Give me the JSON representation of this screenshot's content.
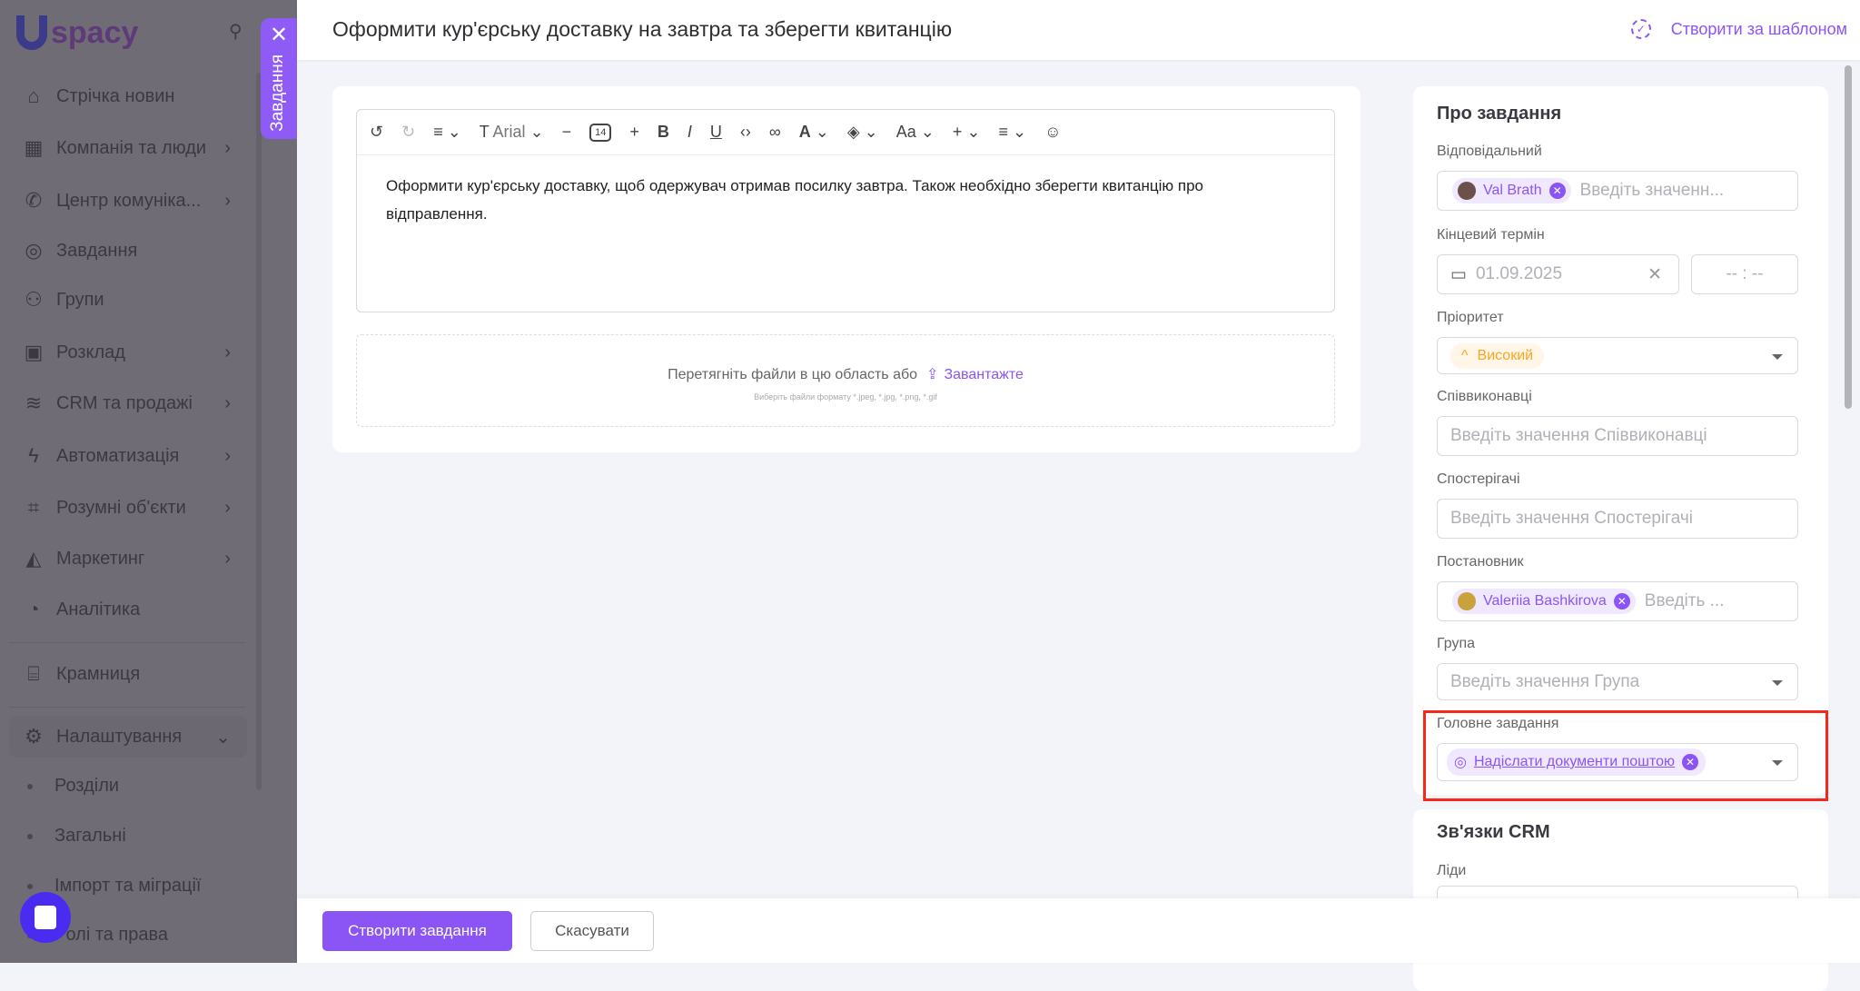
{
  "sidebar": {
    "logo": "spacy",
    "items": [
      {
        "label": "Стрічка новин",
        "icon": "home-icon",
        "chevron": false
      },
      {
        "label": "Компанія та люди",
        "icon": "building-icon",
        "chevron": true
      },
      {
        "label": "Центр комуніка...",
        "icon": "phone-chat-icon",
        "chevron": true
      },
      {
        "label": "Завдання",
        "icon": "check-circle-icon",
        "chevron": false
      },
      {
        "label": "Групи",
        "icon": "users-icon",
        "chevron": false
      },
      {
        "label": "Розклад",
        "icon": "calendar-icon",
        "chevron": true
      },
      {
        "label": "CRM та продажі",
        "icon": "database-icon",
        "chevron": true
      },
      {
        "label": "Автоматизація",
        "icon": "bolt-icon",
        "chevron": true
      },
      {
        "label": "Розумні об'єкти",
        "icon": "scan-icon",
        "chevron": true
      },
      {
        "label": "Маркетинг",
        "icon": "megaphone-icon",
        "chevron": true
      },
      {
        "label": "Аналітика",
        "icon": "chart-icon",
        "chevron": false
      },
      {
        "label": "Крамниця",
        "icon": "store-icon",
        "chevron": false
      },
      {
        "label": "Налаштування",
        "icon": "gear-icon",
        "chevron": true
      }
    ],
    "sub_items": [
      "Розділи",
      "Загальні",
      "Імпорт та міграції",
      "Ролі та права"
    ]
  },
  "side_tab": {
    "label": "Завдання"
  },
  "header": {
    "title": "Оформити кур'єрську доставку на завтра та зберегти квитанцію",
    "template_button": "Створити за шаблоном"
  },
  "editor": {
    "font": "Arial",
    "font_size": "14",
    "text": "Оформити кур'єрську доставку, щоб одержувач отримав посилку завтра. Також необхідно зберегти квитанцію про відправлення."
  },
  "upload": {
    "text": "Перетягніть файли в цю область або",
    "link": "Завантажте",
    "hint": "Виберіть файли формату *.jpeg, *.jpg, *.png, *.gif"
  },
  "about": {
    "title": "Про завдання",
    "responsible": {
      "label": "Відповідальний",
      "chip": "Val Brath",
      "placeholder": "Введіть значенн..."
    },
    "deadline": {
      "label": "Кінцевий термін",
      "date": "01.09.2025",
      "time": "-- : --"
    },
    "priority": {
      "label": "Пріоритет",
      "value": "Високий"
    },
    "coexecutors": {
      "label": "Співвиконавці",
      "placeholder": "Введіть значення Співвиконавці"
    },
    "observers": {
      "label": "Спостерігачі",
      "placeholder": "Введіть значення Спостерігачі"
    },
    "author": {
      "label": "Постановник",
      "chip": "Valeriia Bashkirova",
      "placeholder": "Введіть ..."
    },
    "group": {
      "label": "Група",
      "placeholder": "Введіть значення Група"
    },
    "parent": {
      "label": "Головне завдання",
      "chip": "Надіслати документи поштою"
    }
  },
  "crm": {
    "title": "Зв'язки CRM",
    "leads_label": "Ліди"
  },
  "footer": {
    "create": "Створити завдання",
    "cancel": "Скасувати"
  },
  "colors": {
    "accent": "#8b55f6",
    "priority": "#f5a623",
    "highlight": "#f7281a"
  }
}
